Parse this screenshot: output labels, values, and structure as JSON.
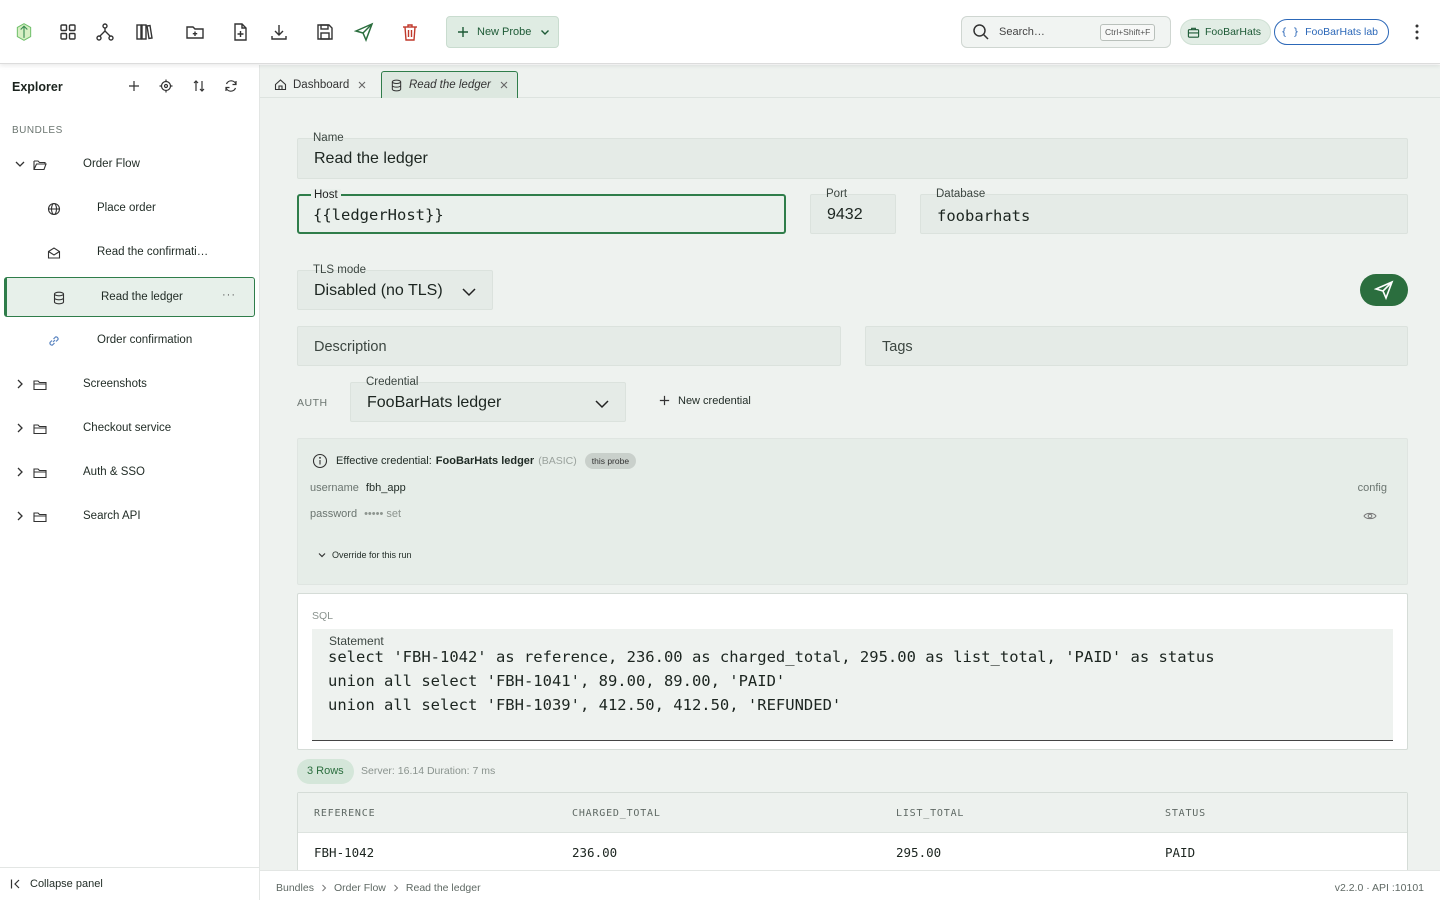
{
  "colors": {
    "brand": "#2b6e3e",
    "accent_blue": "#2c68b8",
    "danger": "#c0392b"
  },
  "toolbar": {
    "icons": [
      "app-logo-icon",
      "grid-icon",
      "branch-icon",
      "library-icon",
      "new-folder-icon",
      "new-file-icon",
      "download-icon",
      "save-icon",
      "send-icon",
      "trash-icon"
    ],
    "new_probe_label": "New Probe",
    "search_placeholder": "Search…",
    "search_shortcut": "Ctrl+Shift+F",
    "workspace": "FooBarHats",
    "environment": "FooBarHats lab",
    "environment_icon": "{ }"
  },
  "sidebar": {
    "title": "Explorer",
    "section": "BUNDLES",
    "tree": [
      {
        "label": "Order Flow",
        "type": "folder",
        "expanded": true
      },
      {
        "label": "Place order",
        "type": "http",
        "icon": "globe-icon"
      },
      {
        "label": "Read the confirmati…",
        "type": "mail",
        "icon": "envelope-icon"
      },
      {
        "label": "Read the ledger",
        "type": "database",
        "icon": "database-icon",
        "active": true,
        "more": "···"
      },
      {
        "label": "Order confirmation",
        "type": "link",
        "icon": "link-icon"
      },
      {
        "label": "Screenshots",
        "type": "folder"
      },
      {
        "label": "Checkout service",
        "type": "folder"
      },
      {
        "label": "Auth & SSO",
        "type": "folder"
      },
      {
        "label": "Search API",
        "type": "folder"
      }
    ],
    "collapse_label": "Collapse panel"
  },
  "tabs": [
    {
      "label": "Dashboard",
      "icon": "home-icon"
    },
    {
      "label": "Read the ledger",
      "icon": "database-icon",
      "active": true
    }
  ],
  "form": {
    "name_label": "Name",
    "name_value": "Read the ledger",
    "host_label": "Host",
    "host_value": "{{ledgerHost}}",
    "port_label": "Port",
    "port_value": "9432",
    "database_label": "Database",
    "database_value": "foobarhats",
    "tls_label": "TLS mode",
    "tls_value": "Disabled (no TLS)",
    "description_placeholder": "Description",
    "tags_placeholder": "Tags"
  },
  "auth": {
    "section_label": "AUTH",
    "credential_label": "Credential",
    "credential_value": "FooBarHats ledger",
    "new_credential_label": "New credential",
    "effective_prefix": "Effective credential:",
    "effective_name": "FooBarHats ledger",
    "effective_type": "(BASIC)",
    "effective_scope": "this probe",
    "username_key": "username",
    "username_value": "fbh_app",
    "password_key": "password",
    "password_value": "••••• set",
    "source_label": "config",
    "override_label": "Override for this run"
  },
  "sql": {
    "tag": "SQL",
    "statement_label": "Statement",
    "lines": [
      "select 'FBH-1042' as reference, 236.00 as charged_total, 295.00 as list_total, 'PAID' as status",
      "union all select 'FBH-1041', 89.00, 89.00, 'PAID'",
      "union all select 'FBH-1039', 412.50, 412.50, 'REFUNDED'"
    ]
  },
  "results": {
    "rows_label": "3 Rows",
    "meta": "Server: 16.14  Duration: 7 ms",
    "columns": [
      "REFERENCE",
      "CHARGED_TOTAL",
      "LIST_TOTAL",
      "STATUS"
    ],
    "rows": [
      [
        "FBH-1042",
        "236.00",
        "295.00",
        "PAID"
      ]
    ]
  },
  "statusbar": {
    "breadcrumb": [
      "Bundles",
      "Order Flow",
      "Read the ledger"
    ],
    "version": "v2.2.0 · API :10101"
  }
}
